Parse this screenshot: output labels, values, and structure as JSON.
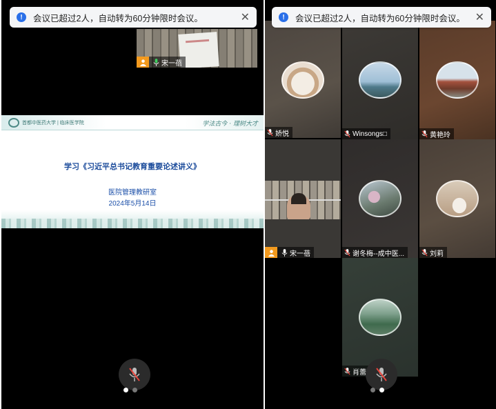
{
  "notice": {
    "icon": "info-icon",
    "message": "会议已超过2人，自动转为60分钟限时会议。",
    "close_glyph": "✕"
  },
  "left_panel": {
    "self_preview_name": "宋一蓓",
    "slide": {
      "school_name": "首都中医药大学 | 临床医学院",
      "motto": "学法古今 · 理树大才",
      "title": "学习《习近平总书记教育重要论述讲义》",
      "department": "医院管理教研室",
      "date": "2024年5月14日"
    },
    "page_dots": [
      true,
      false
    ]
  },
  "right_panel": {
    "participants": [
      {
        "name": "娇悦",
        "avatar": "coffee-avatar",
        "host": false
      },
      {
        "name": "Winsongs□",
        "avatar": "sky-avatar",
        "host": false
      },
      {
        "name": "黄艳玲",
        "avatar": "ship-avatar",
        "host": false
      },
      {
        "name": "宋一蓓",
        "avatar": "video-feed",
        "host": true
      },
      {
        "name": "谢冬梅--成中医...",
        "avatar": "flower-avatar",
        "host": false
      },
      {
        "name": "刘莉",
        "avatar": "girl-avatar",
        "host": false
      },
      {
        "name": "肖蕾",
        "avatar": "lake-avatar",
        "host": false
      }
    ],
    "page_dots": [
      false,
      true
    ]
  },
  "colors": {
    "host_badge": "#f39a1e",
    "info_blue": "#2a6fe8",
    "slide_title": "#1b4b9b"
  }
}
